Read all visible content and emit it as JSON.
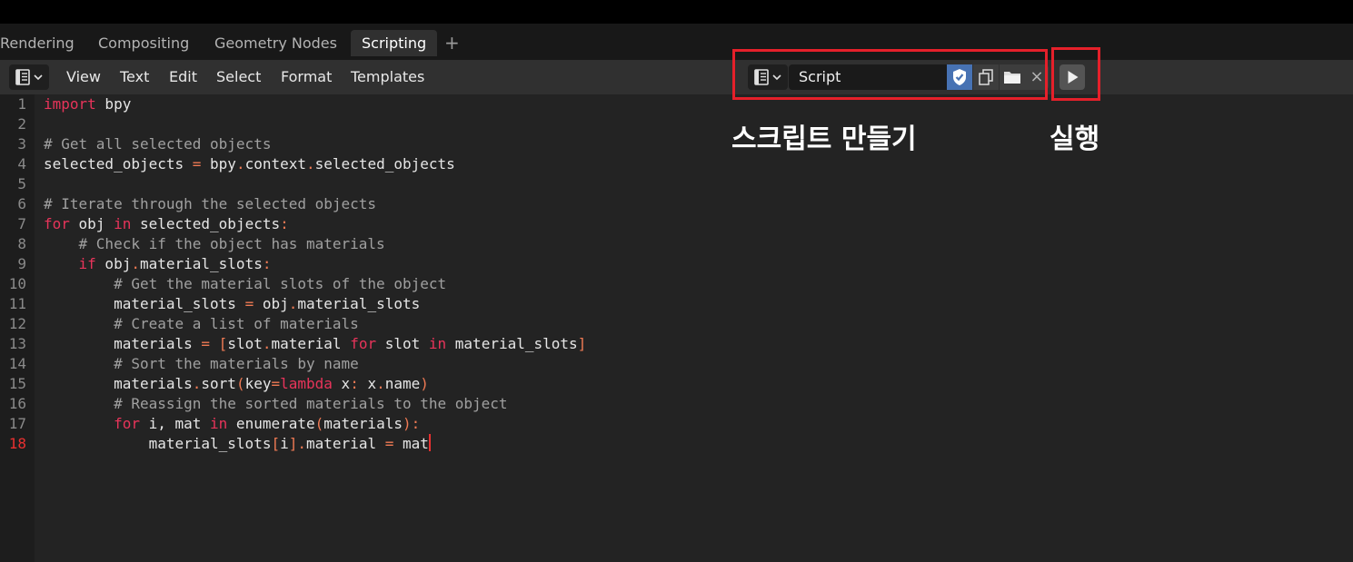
{
  "workspace_tabs": [
    {
      "label": "Rendering",
      "active": false
    },
    {
      "label": "Compositing",
      "active": false
    },
    {
      "label": "Geometry Nodes",
      "active": false
    },
    {
      "label": "Scripting",
      "active": true
    }
  ],
  "add_tab_symbol": "+",
  "header": {
    "editor_type_icon": "text-editor-icon",
    "menus": [
      "View",
      "Text",
      "Edit",
      "Select",
      "Format",
      "Templates"
    ]
  },
  "file": {
    "name": "Script",
    "buttons": [
      {
        "name": "fake-user-shield-icon",
        "active": true
      },
      {
        "name": "new-text-icon",
        "active": false
      },
      {
        "name": "open-folder-icon",
        "active": false
      }
    ],
    "close_symbol": "×"
  },
  "run_button_icon": "play-icon",
  "editor": {
    "current_line": 18,
    "lines": [
      [
        {
          "t": "import",
          "c": "kw"
        },
        {
          "t": " bpy",
          "c": ""
        }
      ],
      [],
      [
        {
          "t": "# Get all selected objects",
          "c": "cm"
        }
      ],
      [
        {
          "t": "selected_objects ",
          "c": ""
        },
        {
          "t": "=",
          "c": "op"
        },
        {
          "t": " bpy",
          "c": ""
        },
        {
          "t": ".",
          "c": "op"
        },
        {
          "t": "context",
          "c": ""
        },
        {
          "t": ".",
          "c": "op"
        },
        {
          "t": "selected_objects",
          "c": ""
        }
      ],
      [],
      [
        {
          "t": "# Iterate through the selected objects",
          "c": "cm"
        }
      ],
      [
        {
          "t": "for",
          "c": "kw"
        },
        {
          "t": " obj ",
          "c": ""
        },
        {
          "t": "in",
          "c": "kw"
        },
        {
          "t": " selected_objects",
          "c": ""
        },
        {
          "t": ":",
          "c": "op"
        }
      ],
      [
        {
          "t": "    ",
          "c": ""
        },
        {
          "t": "# Check if the object has materials",
          "c": "cm"
        }
      ],
      [
        {
          "t": "    ",
          "c": ""
        },
        {
          "t": "if",
          "c": "kw"
        },
        {
          "t": " obj",
          "c": ""
        },
        {
          "t": ".",
          "c": "op"
        },
        {
          "t": "material_slots",
          "c": ""
        },
        {
          "t": ":",
          "c": "op"
        }
      ],
      [
        {
          "t": "        ",
          "c": ""
        },
        {
          "t": "# Get the material slots of the object",
          "c": "cm"
        }
      ],
      [
        {
          "t": "        material_slots ",
          "c": ""
        },
        {
          "t": "=",
          "c": "op"
        },
        {
          "t": " obj",
          "c": ""
        },
        {
          "t": ".",
          "c": "op"
        },
        {
          "t": "material_slots",
          "c": ""
        }
      ],
      [
        {
          "t": "        ",
          "c": ""
        },
        {
          "t": "# Create a list of materials",
          "c": "cm"
        }
      ],
      [
        {
          "t": "        materials ",
          "c": ""
        },
        {
          "t": "=",
          "c": "op"
        },
        {
          "t": " ",
          "c": ""
        },
        {
          "t": "[",
          "c": "op"
        },
        {
          "t": "slot",
          "c": ""
        },
        {
          "t": ".",
          "c": "op"
        },
        {
          "t": "material ",
          "c": ""
        },
        {
          "t": "for",
          "c": "kw"
        },
        {
          "t": " slot ",
          "c": ""
        },
        {
          "t": "in",
          "c": "kw"
        },
        {
          "t": " material_slots",
          "c": ""
        },
        {
          "t": "]",
          "c": "op"
        }
      ],
      [
        {
          "t": "        ",
          "c": ""
        },
        {
          "t": "# Sort the materials by name",
          "c": "cm"
        }
      ],
      [
        {
          "t": "        materials",
          "c": ""
        },
        {
          "t": ".",
          "c": "op"
        },
        {
          "t": "sort",
          "c": ""
        },
        {
          "t": "(",
          "c": "op"
        },
        {
          "t": "key",
          "c": ""
        },
        {
          "t": "=",
          "c": "op"
        },
        {
          "t": "lambda",
          "c": "kw"
        },
        {
          "t": " x",
          "c": ""
        },
        {
          "t": ":",
          "c": "op"
        },
        {
          "t": " x",
          "c": ""
        },
        {
          "t": ".",
          "c": "op"
        },
        {
          "t": "name",
          "c": ""
        },
        {
          "t": ")",
          "c": "op"
        }
      ],
      [
        {
          "t": "        ",
          "c": ""
        },
        {
          "t": "# Reassign the sorted materials to the object",
          "c": "cm"
        }
      ],
      [
        {
          "t": "        ",
          "c": ""
        },
        {
          "t": "for",
          "c": "kw"
        },
        {
          "t": " i, mat ",
          "c": ""
        },
        {
          "t": "in",
          "c": "kw"
        },
        {
          "t": " enumerate",
          "c": ""
        },
        {
          "t": "(",
          "c": "op"
        },
        {
          "t": "materials",
          "c": ""
        },
        {
          "t": ")",
          "c": "op"
        },
        {
          "t": ":",
          "c": "op"
        }
      ],
      [
        {
          "t": "            material_slots",
          "c": ""
        },
        {
          "t": "[",
          "c": "op"
        },
        {
          "t": "i",
          "c": ""
        },
        {
          "t": "]",
          "c": "op"
        },
        {
          "t": ".",
          "c": "op"
        },
        {
          "t": "material ",
          "c": ""
        },
        {
          "t": "=",
          "c": "op"
        },
        {
          "t": " mat",
          "c": ""
        }
      ]
    ]
  },
  "annotations": {
    "create_script": "스크립트 만들기",
    "run": "실행"
  },
  "colors": {
    "highlight_box": "#e5202a",
    "keyword": "#e8345a",
    "comment": "#a0a0a0",
    "operator": "#ef7a54",
    "current_line_number": "#e83030"
  }
}
